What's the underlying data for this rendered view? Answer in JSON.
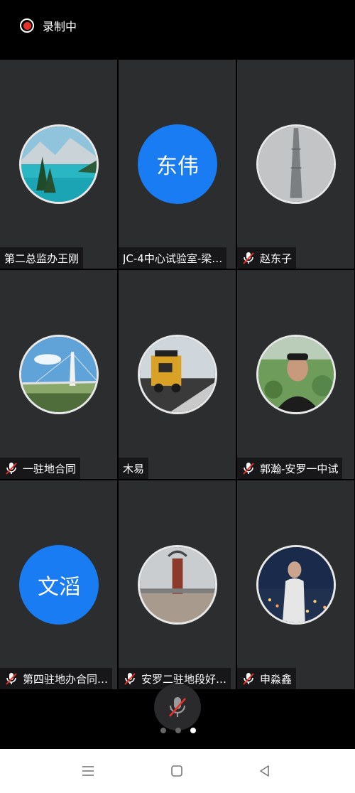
{
  "status": {
    "recording_label": "录制中",
    "recording_color": "#e8302b"
  },
  "participants": [
    {
      "name": "第二总监办王刚",
      "muted": false,
      "avatar": "photo-lake"
    },
    {
      "name": "JC-4中心试验室-梁…",
      "muted": false,
      "avatar_text": "东伟"
    },
    {
      "name": "赵东子",
      "muted": true,
      "avatar": "photo-tower"
    },
    {
      "name": "一驻地合同",
      "muted": true,
      "avatar": "photo-bridge"
    },
    {
      "name": "木易",
      "muted": false,
      "avatar": "photo-paver"
    },
    {
      "name": "郭瀚-安罗一中试",
      "muted": true,
      "avatar": "photo-man"
    },
    {
      "name": "第四驻地办合同…",
      "muted": true,
      "avatar_text": "文滔"
    },
    {
      "name": "安罗二驻地段好…",
      "muted": true,
      "avatar": "photo-monument"
    },
    {
      "name": "申淼鑫",
      "muted": true,
      "avatar": "photo-night"
    }
  ],
  "controls": {
    "mic_icon": "mic-off-icon",
    "page_count": 3,
    "active_page": 3
  },
  "navbar": {
    "items": [
      "menu-icon",
      "home-icon",
      "back-icon"
    ]
  },
  "colors": {
    "tile_bg": "#2b2d2f",
    "avatar_blue": "#1a7cf2",
    "mute_red": "#e8302b"
  }
}
